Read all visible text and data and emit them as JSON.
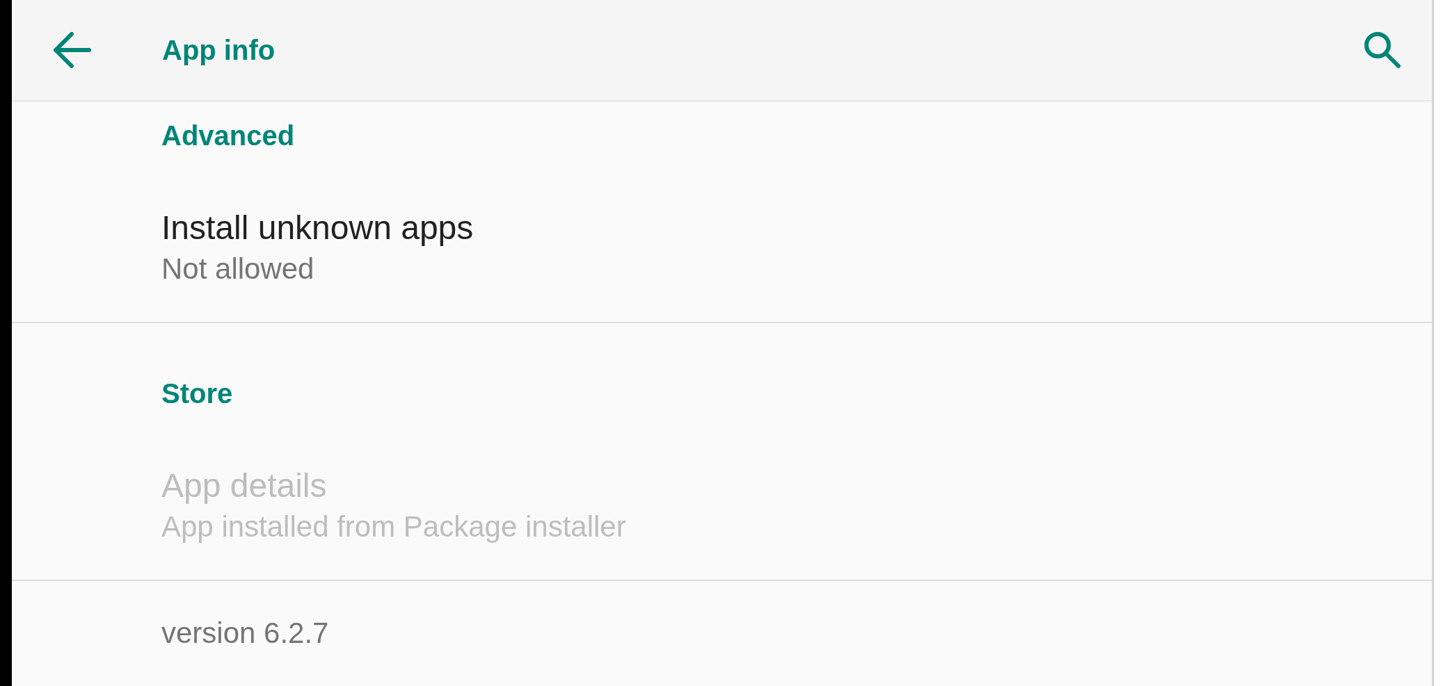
{
  "app_bar": {
    "title": "App info"
  },
  "sections": [
    {
      "title": "Advanced",
      "items": [
        {
          "title": "Install unknown apps",
          "summary": "Not allowed",
          "disabled": false
        }
      ]
    },
    {
      "title": "Store",
      "items": [
        {
          "title": "App details",
          "summary": "App installed from Package installer",
          "disabled": true
        }
      ]
    }
  ],
  "footer": {
    "version": "version 6.2.7"
  }
}
